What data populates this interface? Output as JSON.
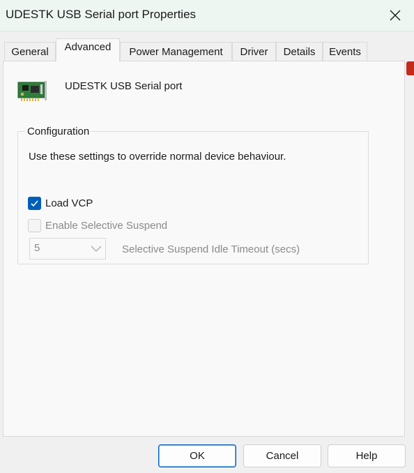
{
  "window": {
    "title": "UDESTK USB Serial port Properties"
  },
  "tabs": [
    {
      "label": "General"
    },
    {
      "label": "Advanced"
    },
    {
      "label": "Power Management"
    },
    {
      "label": "Driver"
    },
    {
      "label": "Details"
    },
    {
      "label": "Events"
    }
  ],
  "active_tab": "Advanced",
  "device": {
    "name": "UDESTK USB Serial port",
    "icon": "network-card-icon"
  },
  "configuration": {
    "group_label": "Configuration",
    "description": "Use these settings to override normal device behaviour.",
    "load_vcp": {
      "label": "Load VCP",
      "checked": true,
      "enabled": true
    },
    "selective_suspend": {
      "label": "Enable Selective Suspend",
      "checked": false,
      "enabled": false
    },
    "idle_timeout": {
      "value": "5",
      "label": "Selective Suspend Idle Timeout (secs)",
      "enabled": false
    }
  },
  "buttons": {
    "ok": "OK",
    "cancel": "Cancel",
    "help": "Help"
  },
  "colors": {
    "accent": "#005fb8",
    "titlebar": "#eef6f2",
    "panel": "#f9f9f9"
  }
}
